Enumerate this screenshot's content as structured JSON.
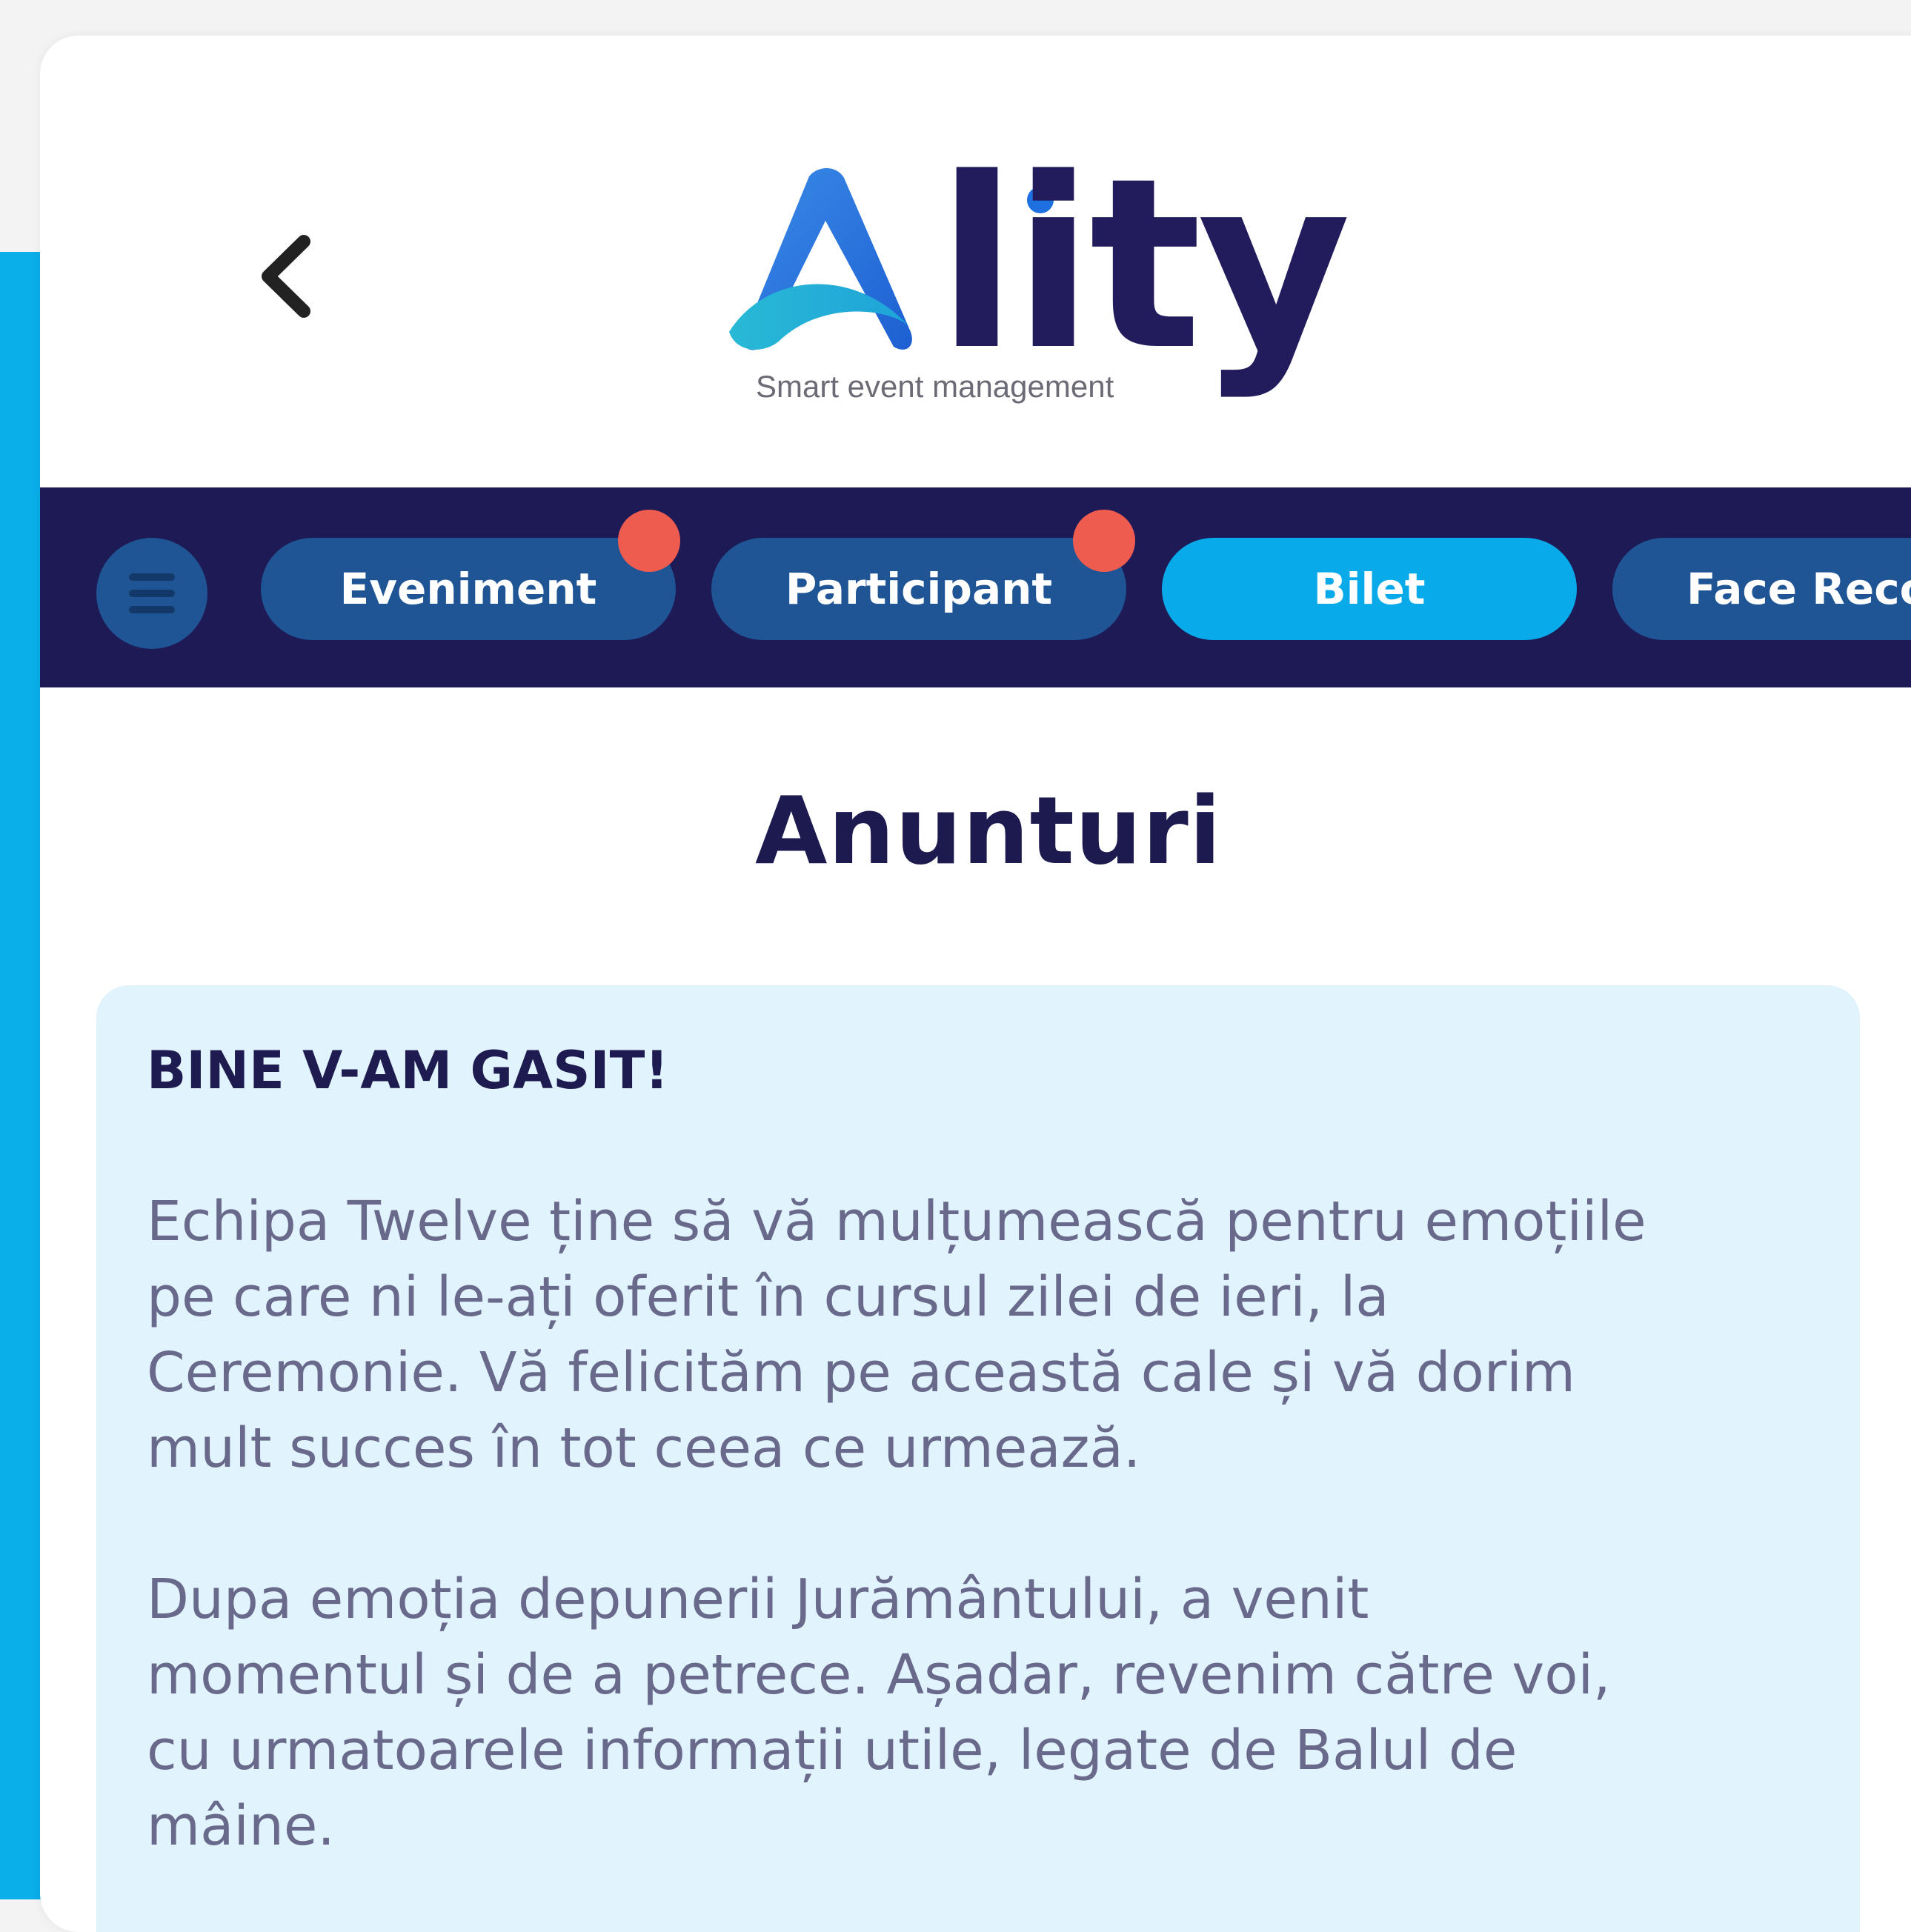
{
  "app": {
    "logo": {
      "wordmark": "Ality",
      "tagline": "Smart event management"
    }
  },
  "header": {
    "back_icon": "chevron-left-icon"
  },
  "nav": {
    "menu_icon": "hamburger-menu-icon",
    "tabs": [
      {
        "label": "Eveniment",
        "active": false,
        "has_notification": true
      },
      {
        "label": "Participant",
        "active": false,
        "has_notification": true
      },
      {
        "label": "Bilet",
        "active": true,
        "has_notification": false
      },
      {
        "label": "Face Reco",
        "active": false,
        "has_notification": false
      }
    ]
  },
  "page": {
    "title": "Anunturi"
  },
  "announcement": {
    "heading": "BINE V-AM GASIT!",
    "paragraph_1": {
      "lines": [
        "Echipa Twelve ține să vă mulțumească pentru emoțiile",
        "pe care ni le-ați oferit în cursul zilei de ieri, la",
        "Ceremonie. Vă felicităm pe această cale și vă dorim",
        "mult succes în tot ceea ce urmează."
      ]
    },
    "paragraph_2": {
      "lines": [
        "Dupa emoția depunerii Jurământului, a venit",
        "momentul și de a petrece. Așadar, revenim către voi,",
        "cu urmatoarele informații utile, legate de Balul de",
        "mâine."
      ]
    }
  },
  "colors": {
    "navbar": "#1e1a55",
    "tab_inactive": "#1f5495",
    "tab_active": "#08aaea",
    "notification": "#ee5c50",
    "card_background": "#e1f3fc",
    "title_text": "#1c1a4e",
    "body_text": "#68698b",
    "side_accent": "#0aaee9"
  }
}
